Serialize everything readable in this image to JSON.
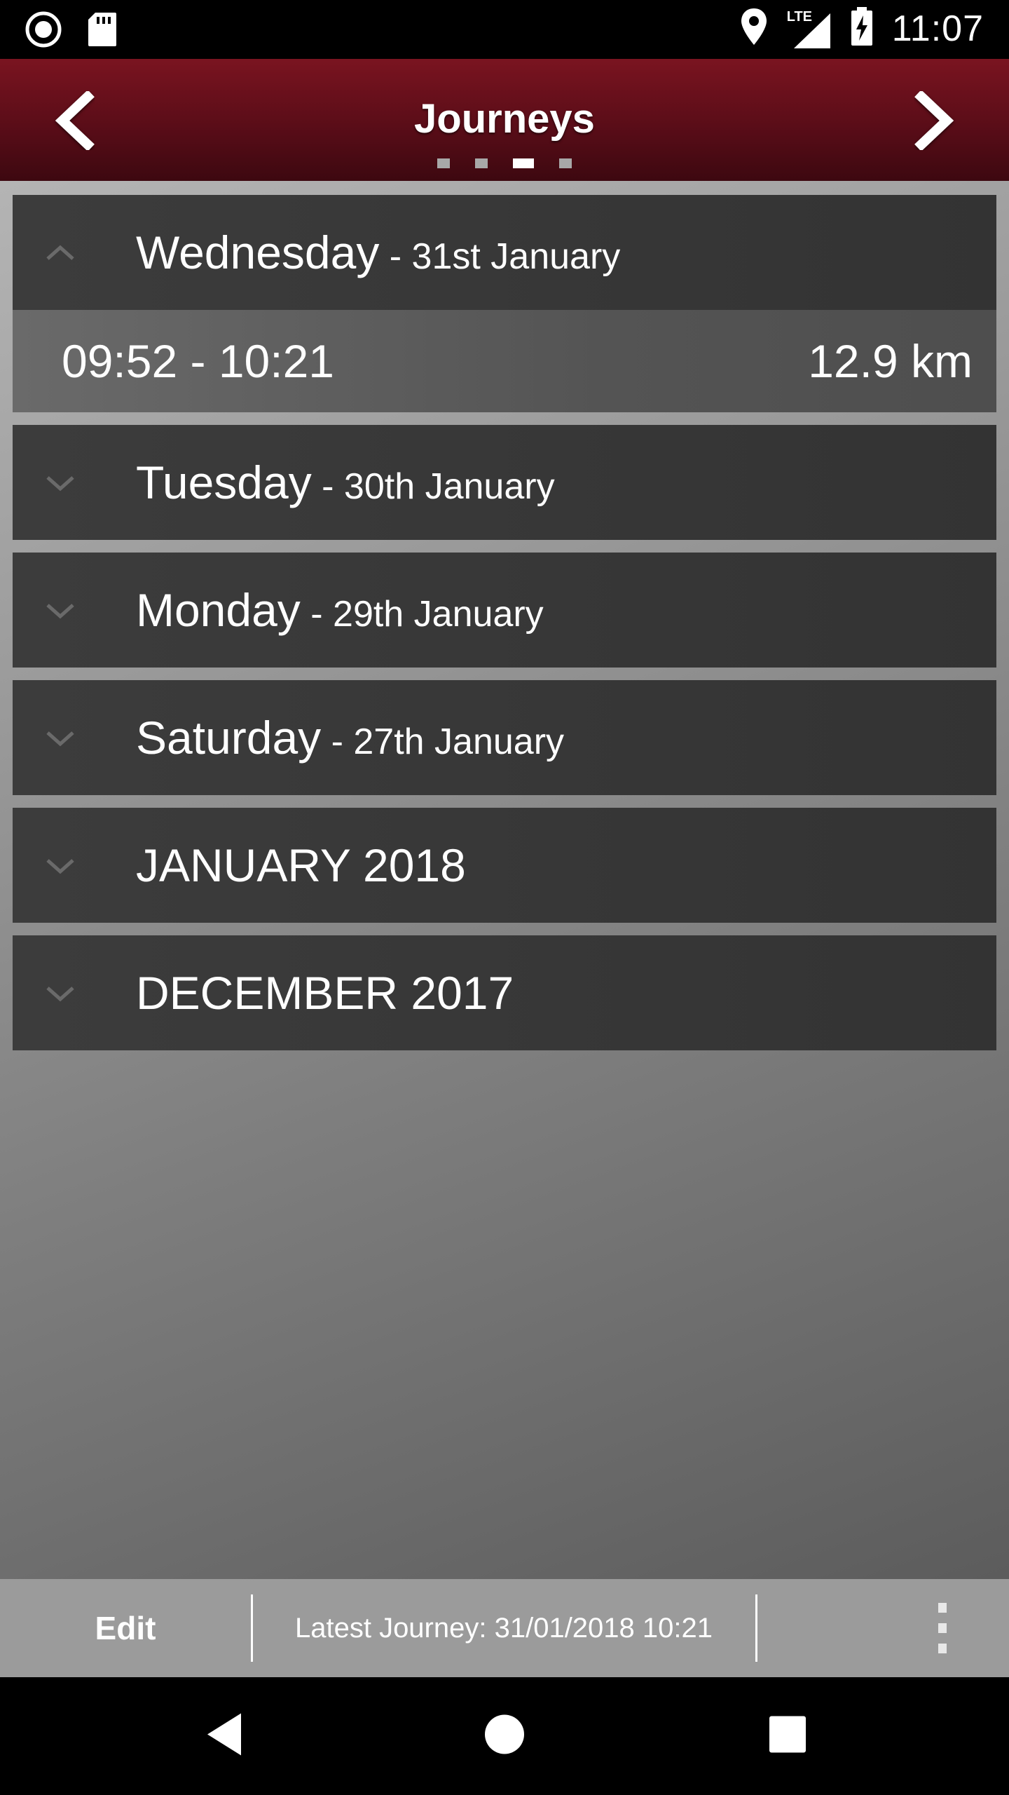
{
  "status_bar": {
    "time": "11:07",
    "network": "LTE"
  },
  "header": {
    "title": "Journeys",
    "pager": {
      "count": 4,
      "active_index": 2
    }
  },
  "sections": [
    {
      "type": "day",
      "expanded": true,
      "day": "Wednesday",
      "date": " - 31st January",
      "journeys": [
        {
          "time": "09:52 - 10:21",
          "distance": "12.9 km"
        }
      ]
    },
    {
      "type": "day",
      "expanded": false,
      "day": "Tuesday",
      "date": " - 30th January"
    },
    {
      "type": "day",
      "expanded": false,
      "day": "Monday",
      "date": " - 29th January"
    },
    {
      "type": "day",
      "expanded": false,
      "day": "Saturday",
      "date": " - 27th January"
    },
    {
      "type": "month",
      "expanded": false,
      "title": "JANUARY 2018"
    },
    {
      "type": "month",
      "expanded": false,
      "title": "DECEMBER 2017"
    }
  ],
  "toolbar": {
    "edit_label": "Edit",
    "latest_journey": "Latest Journey: 31/01/2018 10:21"
  },
  "colors": {
    "header_red": "#7a1420",
    "row_dark": "#363636",
    "toolbar_gray": "#9b9b9b"
  },
  "icons": {
    "status_left": [
      "record-icon",
      "sd-card-icon"
    ],
    "status_right": [
      "location-icon",
      "lte-signal-icon",
      "battery-charging-icon"
    ],
    "header": [
      "chevron-left-icon",
      "chevron-right-icon"
    ],
    "toolbar": [
      "overflow-menu-icon"
    ],
    "nav": [
      "back-icon",
      "home-icon",
      "recents-icon"
    ]
  }
}
